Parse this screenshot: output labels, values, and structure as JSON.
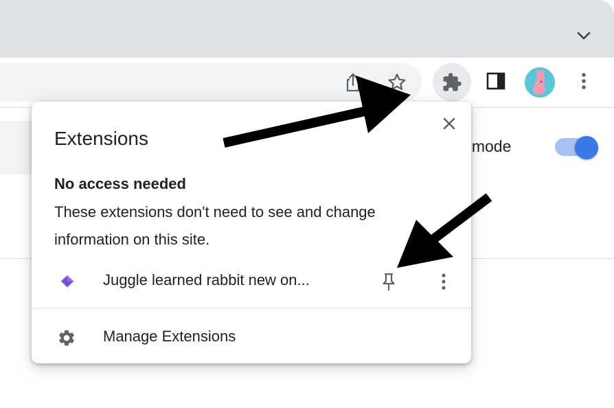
{
  "browser": {
    "tab_dropdown_icon": "chevron-down-icon",
    "toolbar": {
      "icons": [
        "share-icon",
        "star-icon",
        "puzzle-icon",
        "side-panel-icon",
        "avatar",
        "more-vert-icon"
      ],
      "avatar_color": "#5bc4d8"
    }
  },
  "page": {
    "developer_mode_label": "er mode",
    "developer_mode_on": true,
    "toggle_color": "#3b78e7"
  },
  "extensions_popup": {
    "title": "Extensions",
    "section_heading": "No access needed",
    "section_description": "These extensions don't need to see and change information on this site.",
    "extensions": [
      {
        "name": "Juggle learned rabbit new on...",
        "icon": "purple-diamond-icon",
        "pinned": false
      }
    ],
    "manage_label": "Manage Extensions",
    "manage_icon": "gear-icon"
  },
  "annotations": {
    "arrows": [
      "arrow-to-extensions-button",
      "arrow-to-pin-button"
    ],
    "color": "#000000"
  }
}
